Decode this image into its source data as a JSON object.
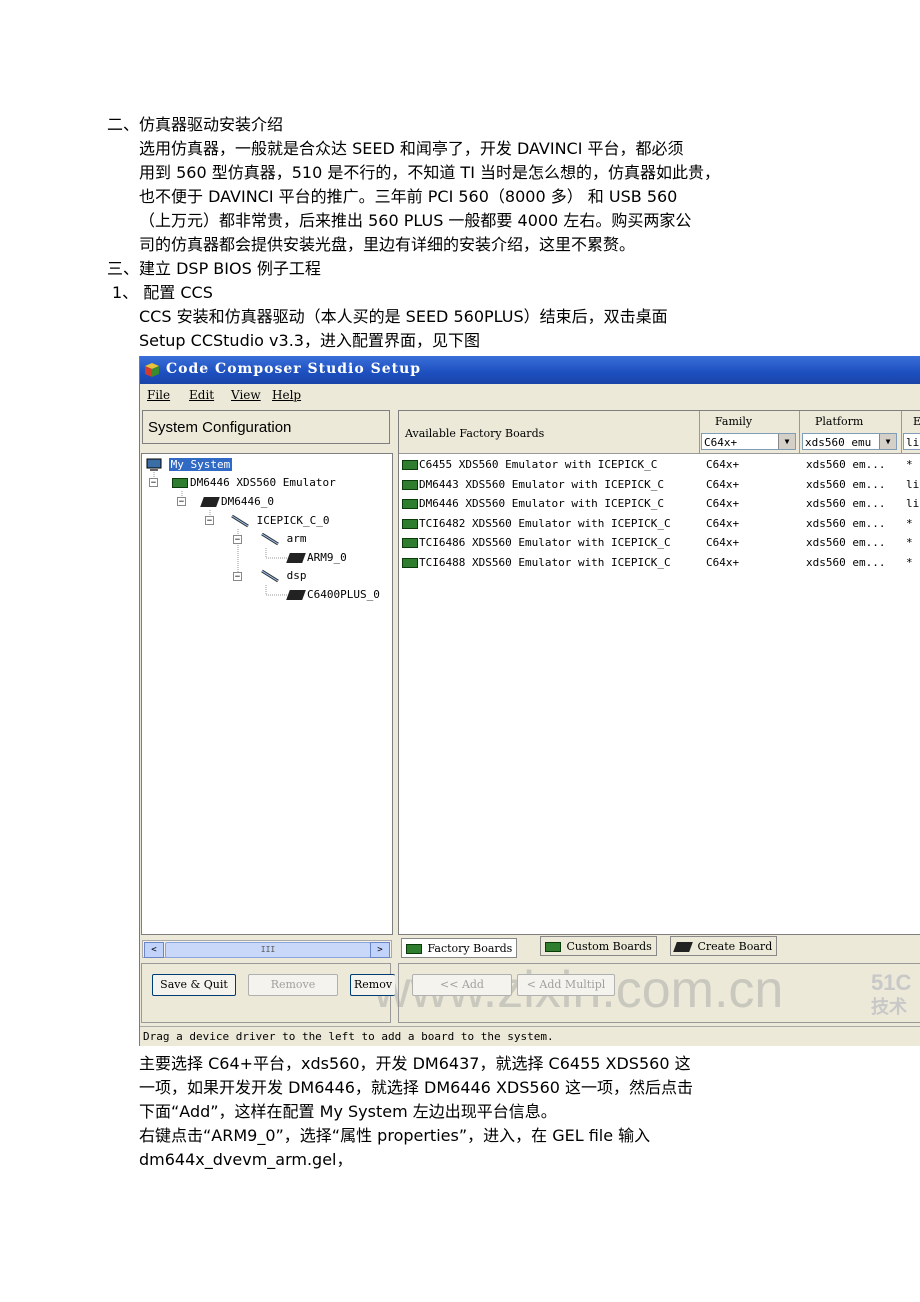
{
  "doc": {
    "section2_title": "二、仿真器驱动安装介绍",
    "para1": [
      "选用仿真器，一般就是合众达 SEED 和闻亭了，开发 DAVINCI 平台，都必须",
      "用到 560 型仿真器，510 是不行的，不知道 TI 当时是怎么想的，仿真器如此贵，",
      "也不便于 DAVINCI 平台的推广。三年前 PCI 560（8000 多） 和 USB 560",
      "（上万元）都非常贵，后来推出 560 PLUS 一般都要 4000 左右。购买两家公",
      "司的仿真器都会提供安装光盘，里边有详细的安装介绍，这里不累赘。"
    ],
    "section3_title": "三、建立 DSP BIOS 例子工程",
    "step1_title": "1、  配置 CCS",
    "para2": [
      "CCS 安装和仿真器驱动（本人买的是 SEED 560PLUS）结束后，双击桌面",
      "Setup CCStudio v3.3，进入配置界面，见下图"
    ],
    "para3": [
      "主要选择 C64+平台，xds560，开发 DM6437，就选择 C6455 XDS560 这",
      "一项，如果开发开发 DM6446，就选择 DM6446 XDS560 这一项，然后点击",
      "下面“Add”，这样在配置 My System 左边出现平台信息。",
      "右键点击“ARM9_0”，选择“属性 properties”，进入，在 GEL file 输入",
      "dm644x_dvevm_arm.gel，"
    ],
    "watermark": "www.zixin.com.cn"
  },
  "window": {
    "title": "Code Composer Studio Setup",
    "menu": [
      "File",
      "Edit",
      "View",
      "Help"
    ],
    "left_header": "System Configuration",
    "tree": [
      {
        "label": "My System",
        "icon": "computer-icon"
      },
      {
        "label": "DM6446 XDS560 Emulator",
        "icon": "board-icon"
      },
      {
        "label": "DM6446_0",
        "icon": "chip-icon"
      },
      {
        "label": "ICEPICK_C_0",
        "icon": "probe-icon"
      },
      {
        "label": "arm",
        "icon": "probe-icon"
      },
      {
        "label": "ARM9_0",
        "icon": "chip-icon"
      },
      {
        "label": "dsp",
        "icon": "probe-icon"
      },
      {
        "label": "C6400PLUS_0",
        "icon": "chip-icon"
      }
    ],
    "scroll_thumb": "III",
    "right_header": "Available Factory Boards",
    "columns": {
      "family": "Family",
      "platform": "Platform",
      "endian": "E"
    },
    "filters": {
      "family": "C64x+",
      "platform": "xds560 emu",
      "endian": "li"
    },
    "boards": [
      {
        "name": "C6455 XDS560 Emulator with ICEPICK_C",
        "family": "C64x+",
        "platform": "xds560 em...",
        "endian": "*"
      },
      {
        "name": "DM6443 XDS560 Emulator with ICEPICK_C",
        "family": "C64x+",
        "platform": "xds560 em...",
        "endian": "li"
      },
      {
        "name": "DM6446 XDS560 Emulator with ICEPICK_C",
        "family": "C64x+",
        "platform": "xds560 em...",
        "endian": "li"
      },
      {
        "name": "TCI6482 XDS560 Emulator with ICEPICK_C",
        "family": "C64x+",
        "platform": "xds560 em...",
        "endian": "*"
      },
      {
        "name": "TCI6486 XDS560 Emulator with ICEPICK_C",
        "family": "C64x+",
        "platform": "xds560 em...",
        "endian": "*"
      },
      {
        "name": "TCI6488 XDS560 Emulator with ICEPICK_C",
        "family": "C64x+",
        "platform": "xds560 em...",
        "endian": "*"
      }
    ],
    "tabs": [
      "Factory Boards",
      "Custom Boards",
      "Create Board"
    ],
    "buttons": {
      "save_quit": "Save & Quit",
      "remove": "Remove",
      "remove_all": "Remov",
      "add": "<< Add",
      "add_multiple": "< Add Multipl"
    },
    "status": "Drag a device driver to the left to add a board to the system.",
    "corner_logo": [
      "51C",
      "技术"
    ]
  }
}
